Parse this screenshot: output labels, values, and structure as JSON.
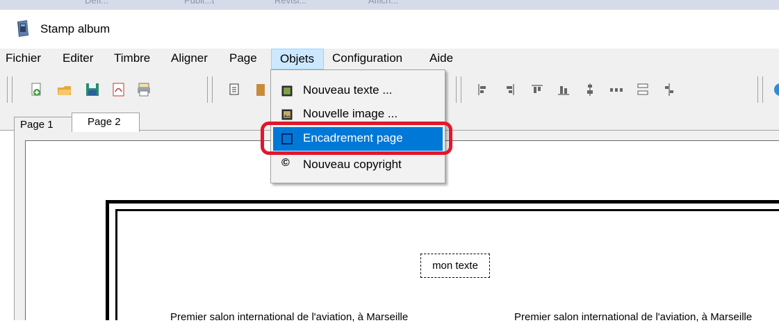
{
  "top_strip": [
    "Défi...",
    "Publi...t",
    "Révisi...",
    "Affich..."
  ],
  "window": {
    "title": "Stamp album"
  },
  "menubar": {
    "items": [
      "Fichier",
      "Editer",
      "Timbre",
      "Aligner",
      "Page",
      "Objets",
      "Configuration",
      "Aide"
    ],
    "open_menu": "Objets"
  },
  "objets_menu": {
    "items": [
      {
        "label": "Nouveau texte ...",
        "icon": "text-icon"
      },
      {
        "label": "Nouvelle image ...",
        "icon": "image-icon"
      },
      {
        "label": "Encadrement page",
        "icon": "frame-icon",
        "highlighted": true
      },
      {
        "label": "Nouveau copyright",
        "icon": "copyright-icon",
        "glyph": "©"
      }
    ]
  },
  "toolbar": {
    "icons": [
      "new-icon",
      "open-icon",
      "save-icon",
      "pdf-icon",
      "print-icon",
      "copy-icon",
      "paste-icon",
      "align-left-icon",
      "align-right-icon",
      "align-top-icon",
      "align-bottom-icon",
      "center-vertical-icon",
      "distribute-horizontal-icon",
      "distribute-vertical-icon",
      "align-center-icon"
    ]
  },
  "tabs": [
    {
      "label": "Page 1",
      "active": false
    },
    {
      "label": "Page 2",
      "active": true
    }
  ],
  "page": {
    "text_box": "mon texte",
    "caption_left": "Premier salon international de l'aviation, à Marseille",
    "caption_right": "Premier salon international de l'aviation, à Marseille"
  },
  "colors": {
    "highlight": "#0078d7",
    "annotation_ring": "#e3162c",
    "menu_bg": "#f0f0f0"
  }
}
